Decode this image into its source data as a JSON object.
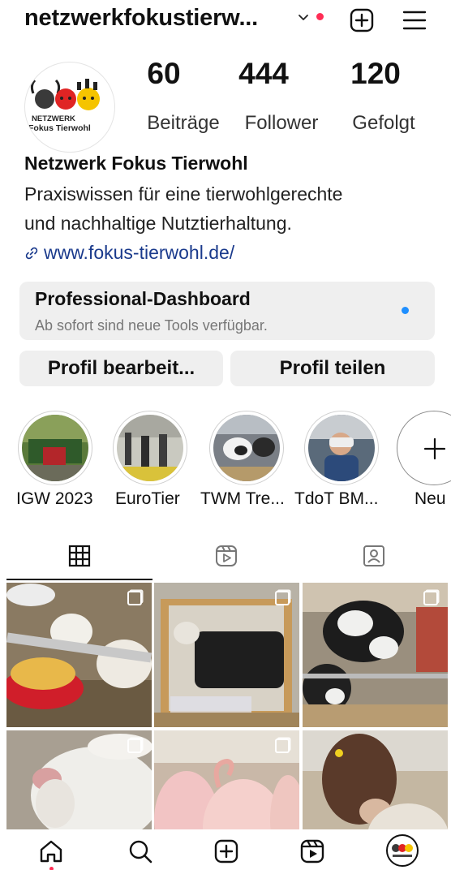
{
  "header": {
    "username": "netzwerkfokustierw...",
    "has_notification_dot": true
  },
  "profile": {
    "logo_text_line1": "NETZWERK",
    "logo_text_line2": "Fokus Tierwohl",
    "stats": [
      {
        "value": "60",
        "label": "Beiträge"
      },
      {
        "value": "444",
        "label": "Follower"
      },
      {
        "value": "120",
        "label": "Gefolgt"
      }
    ],
    "name": "Netzwerk Fokus Tierwohl",
    "bio_line1": "Praxiswissen für eine tierwohlgerechte",
    "bio_line2": "und nachhaltige Nutztierhaltung.",
    "link": "www.fokus-tierwohl.de/"
  },
  "dashboard": {
    "title": "Professional-Dashboard",
    "subtitle": "Ab sofort sind neue Tools verfügbar."
  },
  "buttons": {
    "edit": "Profil bearbeit...",
    "share": "Profil teilen"
  },
  "highlights": [
    {
      "label": "IGW 2023"
    },
    {
      "label": "EuroTier"
    },
    {
      "label": "TWM Tre..."
    },
    {
      "label": "TdoT BM..."
    }
  ],
  "new_highlight_label": "Neu",
  "tabs": [
    "grid-icon",
    "reels-icon",
    "tagged-icon"
  ],
  "colors": {
    "accent_blue": "#1f8fff",
    "notification_red": "#ff2d55",
    "link_blue": "#1a3a8c"
  }
}
